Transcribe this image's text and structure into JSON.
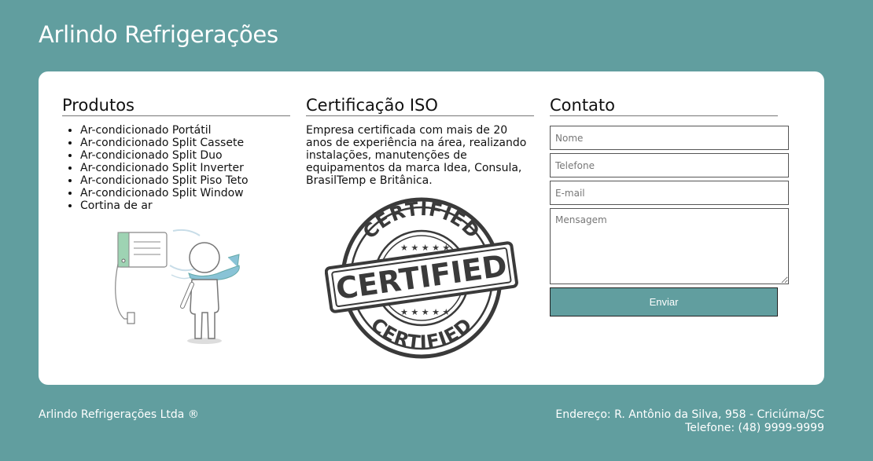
{
  "header": {
    "title": "Arlindo Refrigerações"
  },
  "produtos": {
    "heading": "Produtos",
    "items": [
      "Ar-condicionado Portátil",
      "Ar-condicionado Split Cassete",
      "Ar-condicionado Split Duo",
      "Ar-condicionado Split Inverter",
      "Ar-condicionado Split Piso Teto",
      "Ar-condicionado Split Window",
      "Cortina de ar"
    ]
  },
  "iso": {
    "heading": "Certificação ISO",
    "text": "Empresa certificada com mais de 20 anos de experiência na área, realizando instalações, manutenções de equipamentos da marca Idea, Consula, BrasilTemp e Britânica.",
    "stamp_word": "CERTIFIED"
  },
  "contato": {
    "heading": "Contato",
    "nome_placeholder": "Nome",
    "telefone_placeholder": "Telefone",
    "email_placeholder": "E-mail",
    "mensagem_placeholder": "Mensagem",
    "send_label": "Enviar"
  },
  "footer": {
    "company": "Arlindo Refrigerações Ltda ®",
    "address": "Endereço: R. Antônio da Silva, 958 - Criciúma/SC",
    "phone": "Telefone: (48) 9999-9999"
  },
  "colors": {
    "background": "#619e9f",
    "accent": "#619e9f",
    "card": "#ffffff"
  }
}
